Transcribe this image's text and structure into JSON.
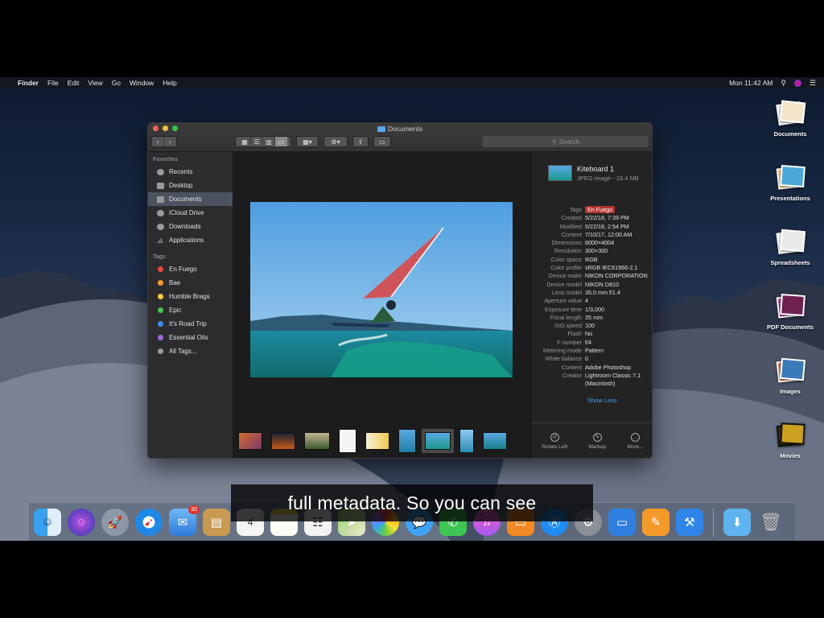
{
  "menubar": {
    "app": "Finder",
    "items": [
      "File",
      "Edit",
      "View",
      "Go",
      "Window",
      "Help"
    ],
    "clock": "Mon 11:42 AM"
  },
  "window": {
    "title": "Documents",
    "search_placeholder": "Search"
  },
  "sidebar": {
    "favorites_header": "Favorites",
    "favorites": [
      {
        "label": "Recents",
        "icon": "clock-icon"
      },
      {
        "label": "Desktop",
        "icon": "desktop-icon"
      },
      {
        "label": "Documents",
        "icon": "document-icon",
        "selected": true
      },
      {
        "label": "iCloud Drive",
        "icon": "cloud-icon"
      },
      {
        "label": "Downloads",
        "icon": "download-icon"
      },
      {
        "label": "Applications",
        "icon": "applications-icon"
      }
    ],
    "tags_header": "Tags",
    "tags": [
      {
        "label": "En Fuego",
        "color": "#e84a3f"
      },
      {
        "label": "Bae",
        "color": "#f39a2b"
      },
      {
        "label": "Humble Brags",
        "color": "#f3d23a"
      },
      {
        "label": "Epic",
        "color": "#49c14f"
      },
      {
        "label": "It's Road Trip",
        "color": "#3b8ef0"
      },
      {
        "label": "Essential Oils",
        "color": "#9b6ad8"
      },
      {
        "label": "All Tags...",
        "color": "#9a9a9a"
      }
    ]
  },
  "inspector": {
    "name": "Kiteboard 1",
    "subtitle": "JPEG image - 15.4 MB",
    "meta": [
      {
        "k": "Tags",
        "v": "En Fuego",
        "tag": true
      },
      {
        "k": "Created",
        "v": "5/22/18, 7:39 PM"
      },
      {
        "k": "Modified",
        "v": "5/22/18, 2:54 PM"
      },
      {
        "k": "Content",
        "v": "7/10/17, 12:00 AM"
      },
      {
        "k": "Dimensions",
        "v": "6000×4004"
      },
      {
        "k": "Resolution",
        "v": "300×300"
      },
      {
        "k": "Color space",
        "v": "RGB"
      },
      {
        "k": "Color profile",
        "v": "sRGB IEC61966-2.1"
      },
      {
        "k": "Device make",
        "v": "NIKON CORPORATION",
        "wrap": true
      },
      {
        "k": "Device model",
        "v": "NIKON D810"
      },
      {
        "k": "Lens model",
        "v": "35.0 mm f/1.4"
      },
      {
        "k": "Aperture value",
        "v": "4"
      },
      {
        "k": "Exposure time",
        "v": "1/3,000"
      },
      {
        "k": "Focal length",
        "v": "35 mm"
      },
      {
        "k": "ISO speed",
        "v": "100"
      },
      {
        "k": "Flash",
        "v": "No"
      },
      {
        "k": "F number",
        "v": "f/4"
      },
      {
        "k": "Metering mode",
        "v": "Pattern"
      },
      {
        "k": "White balance",
        "v": "0"
      },
      {
        "k": "Content",
        "v": "Adobe Photoshop"
      },
      {
        "k": "Creator",
        "v": "Lightroom Classic 7.1 (Macintosh)",
        "wrap": true
      }
    ],
    "show_less": "Show Less",
    "actions": [
      "Rotate Left",
      "Markup",
      "More..."
    ]
  },
  "desktop_icons": [
    "Documents",
    "Presentations",
    "Spreadsheets",
    "PDF Documents",
    "Images",
    "Movies"
  ],
  "dock": {
    "mail_badge": "30",
    "calendar_day": "4"
  },
  "caption": "full metadata.  So you can see"
}
